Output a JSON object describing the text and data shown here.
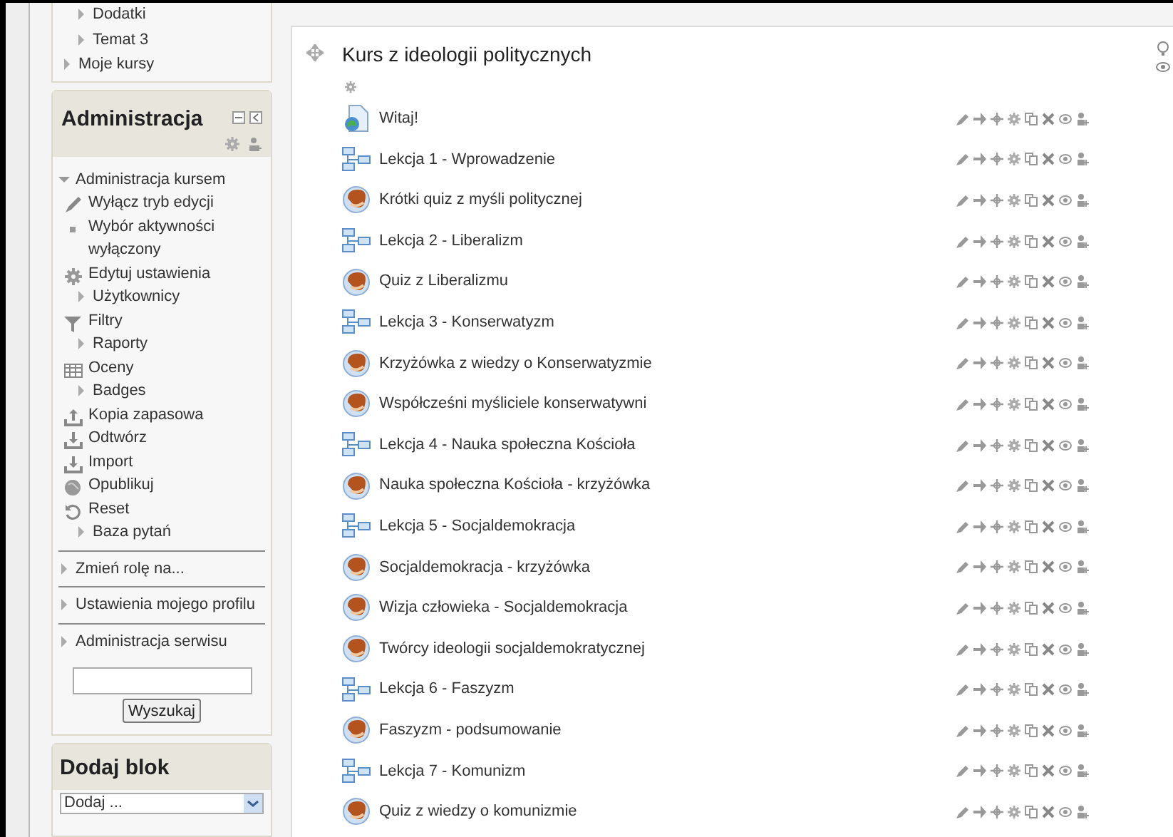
{
  "navigation_block": {
    "nested_items": [
      {
        "label": "Dodatki",
        "expanded": false
      },
      {
        "label": "Temat 3",
        "expanded": false
      }
    ],
    "items": [
      {
        "label": "Moje kursy",
        "expanded": false
      }
    ]
  },
  "administration_block": {
    "title": "Administracja",
    "items": [
      {
        "label": "Administracja kursem",
        "kind": "node",
        "expanded": true,
        "children": [
          {
            "label": "Wyłącz tryb edycji",
            "kind": "pencil"
          },
          {
            "label": "Wybór aktywności wyłączony",
            "kind": "bullet"
          },
          {
            "label": "Edytuj ustawienia",
            "kind": "gear"
          },
          {
            "label": "Użytkownicy",
            "kind": "node",
            "expanded": false
          },
          {
            "label": "Filtry",
            "kind": "filter"
          },
          {
            "label": "Raporty",
            "kind": "node",
            "expanded": false
          },
          {
            "label": "Oceny",
            "kind": "grades"
          },
          {
            "label": "Badges",
            "kind": "node",
            "expanded": false
          },
          {
            "label": "Kopia zapasowa",
            "kind": "upload"
          },
          {
            "label": "Odtwórz",
            "kind": "download"
          },
          {
            "label": "Import",
            "kind": "download"
          },
          {
            "label": "Opublikuj",
            "kind": "globe"
          },
          {
            "label": "Reset",
            "kind": "reset"
          },
          {
            "label": "Baza pytań",
            "kind": "node",
            "expanded": false
          }
        ]
      },
      {
        "label": "Zmień rolę na...",
        "kind": "node",
        "expanded": false
      },
      {
        "label": "Ustawienia mojego profilu",
        "kind": "node",
        "expanded": false
      },
      {
        "label": "Administracja serwisu",
        "kind": "node",
        "expanded": false
      }
    ],
    "search_button": "Wyszukaj"
  },
  "add_block": {
    "title": "Dodaj blok",
    "select": "Dodaj ..."
  },
  "section": {
    "title": "Kurs z ideologii politycznych",
    "activities": [
      {
        "kind": "page",
        "name": "Witaj!"
      },
      {
        "kind": "lesson",
        "name": "Lekcja 1 - Wprowadzenie"
      },
      {
        "kind": "quiz",
        "name": "Krótki quiz z myśli politycznej"
      },
      {
        "kind": "lesson",
        "name": "Lekcja 2 - Liberalizm"
      },
      {
        "kind": "quiz",
        "name": "Quiz z Liberalizmu"
      },
      {
        "kind": "lesson",
        "name": "Lekcja 3 - Konserwatyzm"
      },
      {
        "kind": "quiz",
        "name": "Krzyżówka z wiedzy o Konserwatyzmie"
      },
      {
        "kind": "quiz",
        "name": "Współcześni myśliciele konserwatywni"
      },
      {
        "kind": "lesson",
        "name": "Lekcja 4 - Nauka społeczna Kościoła"
      },
      {
        "kind": "quiz",
        "name": "Nauka społeczna Kościoła - krzyżówka"
      },
      {
        "kind": "lesson",
        "name": "Lekcja 5 - Socjaldemokracja"
      },
      {
        "kind": "quiz",
        "name": "Socjaldemokracja - krzyżówka"
      },
      {
        "kind": "quiz",
        "name": "Wizja człowieka - Socjaldemokracja"
      },
      {
        "kind": "quiz",
        "name": "Twórcy ideologii socjaldemokratycznej"
      },
      {
        "kind": "lesson",
        "name": "Lekcja 6 - Faszyzm"
      },
      {
        "kind": "quiz",
        "name": "Faszyzm - podsumowanie"
      },
      {
        "kind": "lesson",
        "name": "Lekcja 7 - Komunizm"
      },
      {
        "kind": "quiz",
        "name": "Quiz z wiedzy o komunizmie"
      }
    ]
  }
}
